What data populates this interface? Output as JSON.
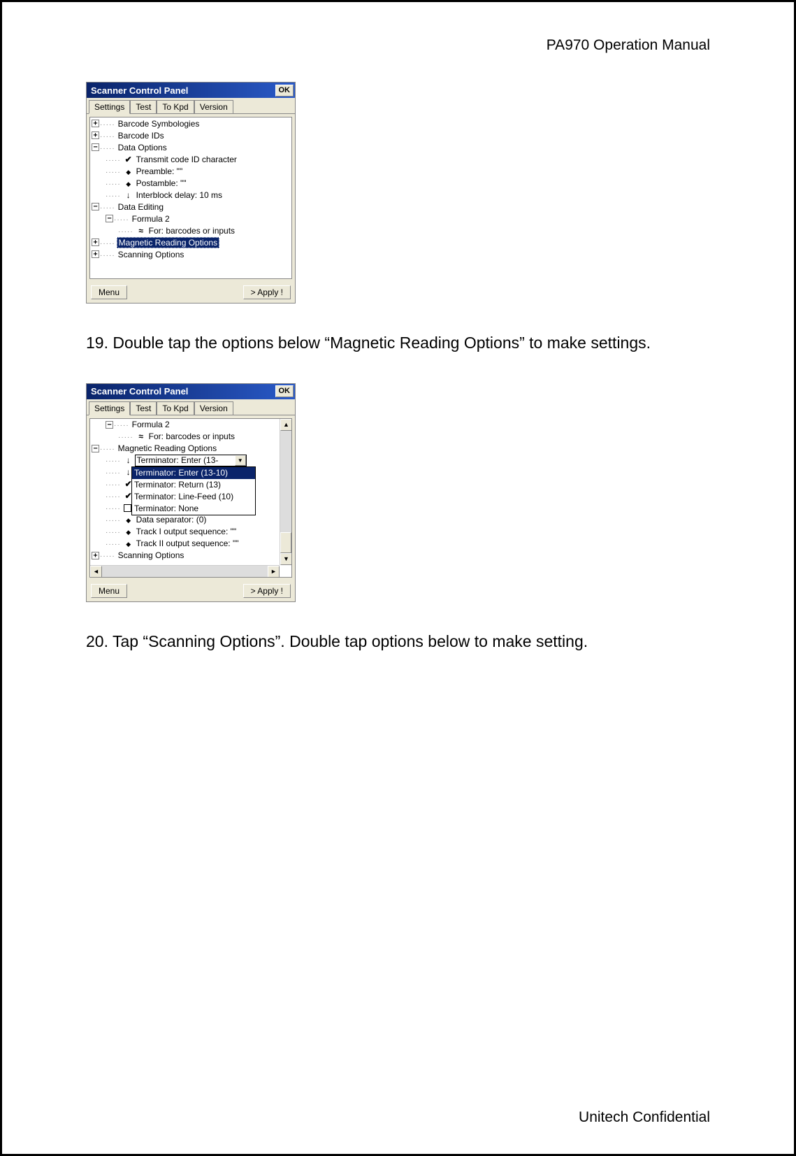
{
  "doc": {
    "header": "PA970 Operation Manual",
    "footer": "Unitech Confidential",
    "step19": "19. Double tap the options below “Magnetic Reading Options” to make settings.",
    "step20": "20. Tap “Scanning Options”. Double tap options below to make setting."
  },
  "window": {
    "title": "Scanner Control Panel",
    "ok": "OK",
    "tabs": [
      "Settings",
      "Test",
      "To Kpd",
      "Version"
    ],
    "active_tab": 0,
    "menu_btn": "Menu",
    "apply_btn": "> Apply !"
  },
  "screenshot1": {
    "tree": {
      "barcode_symbologies": "Barcode Symbologies",
      "barcode_ids": "Barcode IDs",
      "data_options": "Data Options",
      "transmit_code_id": "Transmit code ID character",
      "preamble": "Preamble: \"\"",
      "postamble": "Postamble: \"\"",
      "interblock": "Interblock delay: 10 ms",
      "data_editing": "Data Editing",
      "formula2": "Formula 2",
      "for_barcodes": "For: barcodes or inputs",
      "magnetic_reading": "Magnetic Reading Options",
      "scanning_options": "Scanning Options"
    }
  },
  "screenshot2": {
    "tree": {
      "formula2": "Formula 2",
      "for_barcodes": "For: barcodes or inputs",
      "magnetic_reading": "Magnetic Reading Options",
      "dropdown_selected": "Terminator: Enter (13-",
      "dropdown_options": [
        "Terminator: Enter (13-10)",
        "Terminator: Return (13)",
        "Terminator: Line-Feed (10)",
        "Terminator: None"
      ],
      "dropdown_selected_index": 0,
      "data_separator": "Data separator: (0)",
      "track1": "Track I output sequence: \"\"",
      "track2": "Track II output sequence: \"\"",
      "scanning_options": "Scanning Options"
    }
  }
}
